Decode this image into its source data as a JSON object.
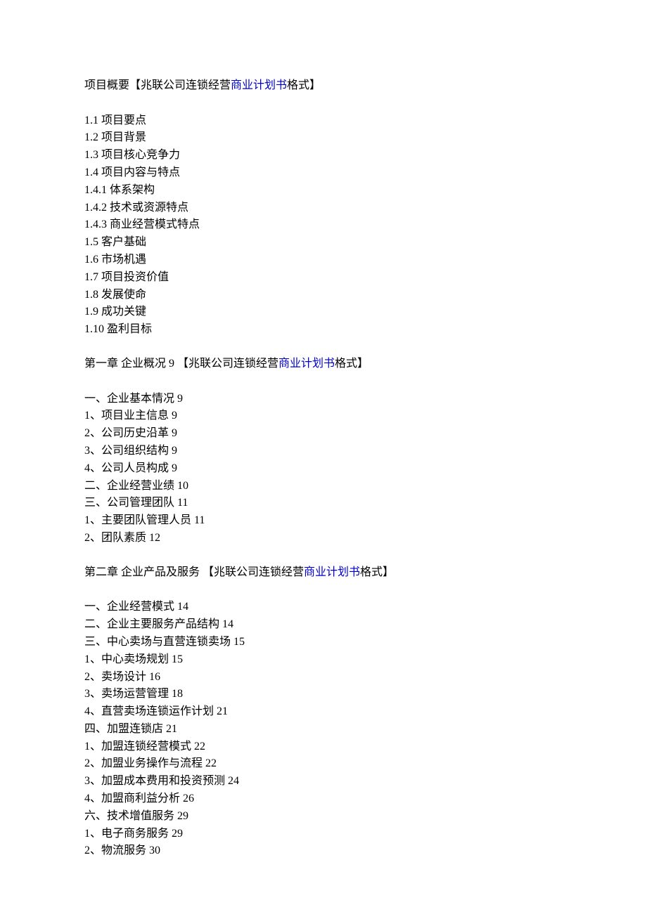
{
  "sections": [
    {
      "heading": [
        {
          "text": "项目概要【兆联公司连锁经营",
          "link": false
        },
        {
          "text": "商业计划书",
          "link": true
        },
        {
          "text": "格式】",
          "link": false
        }
      ],
      "lines": [
        "1.1 项目要点",
        "1.2 项目背景",
        "1.3 项目核心竞争力",
        "1.4 项目内容与特点",
        "1.4.1 体系架构",
        "1.4.2 技术或资源特点",
        "1.4.3 商业经营模式特点",
        "1.5 客户基础",
        "1.6 市场机遇",
        "1.7 项目投资价值",
        "1.8 发展使命",
        "1.9 成功关键",
        "1.10 盈利目标"
      ]
    },
    {
      "heading": [
        {
          "text": "第一章 企业概况 9 【兆联公司连锁经营",
          "link": false
        },
        {
          "text": "商业计划书",
          "link": true
        },
        {
          "text": "格式】",
          "link": false
        }
      ],
      "lines": [
        "一、企业基本情况 9",
        "1、项目业主信息 9",
        "2、公司历史沿革 9",
        "3、公司组织结构 9",
        "4、公司人员构成 9",
        "二、企业经营业绩 10",
        "三、公司管理团队 11",
        "1、主要团队管理人员 11",
        "2、团队素质 12"
      ]
    },
    {
      "heading": [
        {
          "text": "第二章 企业产品及服务 【兆联公司连锁经营",
          "link": false
        },
        {
          "text": "商业计划书",
          "link": true
        },
        {
          "text": "格式】",
          "link": false
        }
      ],
      "lines": [
        "一、企业经营模式 14",
        "二、企业主要服务产品结构 14",
        "三、中心卖场与直营连锁卖场 15",
        "1、中心卖场规划 15",
        "2、卖场设计 16",
        "3、卖场运营管理 18",
        "4、直营卖场连锁运作计划 21",
        "四、加盟连锁店 21",
        "1、加盟连锁经营模式 22",
        "2、加盟业务操作与流程 22",
        "3、加盟成本费用和投资预测 24",
        "4、加盟商利益分析 26",
        "六、技术增值服务 29",
        "1、电子商务服务 29",
        "2、物流服务 30"
      ]
    }
  ]
}
